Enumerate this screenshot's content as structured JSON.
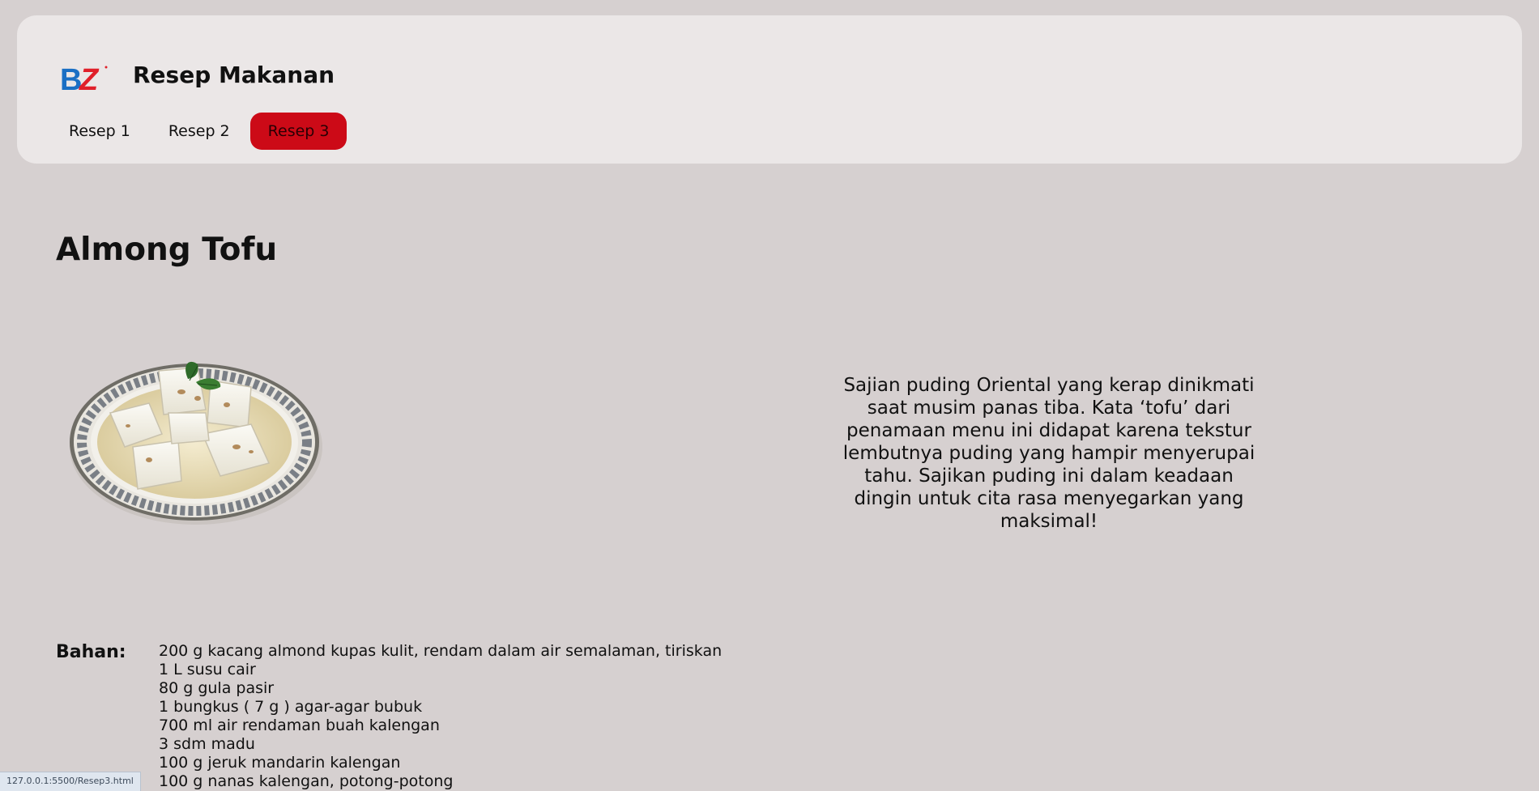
{
  "header": {
    "logo_text": "BZ",
    "title": "Resep Makanan",
    "nav": [
      {
        "label": "Resep 1",
        "active": false
      },
      {
        "label": "Resep 2",
        "active": false
      },
      {
        "label": "Resep 3",
        "active": true
      }
    ]
  },
  "recipe": {
    "title": "Almong Tofu",
    "image_icon": "almond-tofu-dish",
    "description": "Sajian puding Oriental yang kerap dinikmati saat musim panas tiba. Kata ‘tofu’ dari penamaan menu ini didapat karena tekstur lembutnya puding yang hampir menyerupai tahu. Sajikan puding ini dalam keadaan dingin untuk cita rasa menyegarkan yang maksimal!",
    "ingredients_label": "Bahan:",
    "ingredients": [
      "200 g kacang almond kupas kulit, rendam dalam air semalaman, tiriskan",
      "1 L susu cair",
      "80 g gula pasir",
      "1 bungkus ( 7 g ) agar-agar bubuk",
      "700 ml air rendaman buah kalengan",
      "3 sdm madu",
      "100 g jeruk mandarin kalengan",
      "100 g nanas kalengan, potong-potong"
    ]
  },
  "status_bar": {
    "url": "127.0.0.1:5500/Resep3.html"
  },
  "colors": {
    "background": "#d6d0d0",
    "header_background": "#ebe7e7",
    "active_nav": "#cc0a17",
    "logo_blue": "#1a6fc4",
    "logo_red": "#e0202a"
  }
}
